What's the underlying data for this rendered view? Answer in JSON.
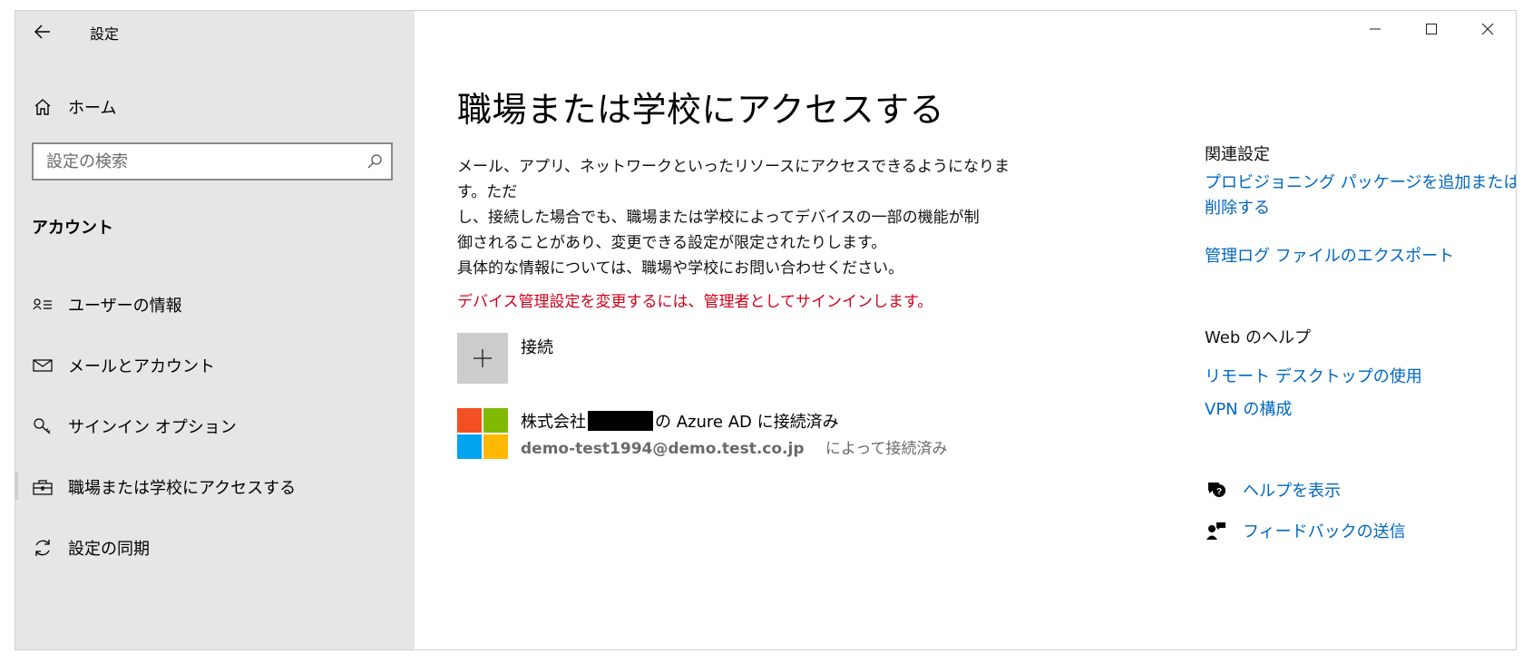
{
  "window": {
    "title": "設定",
    "back_icon": "back-arrow-icon",
    "controls": {
      "minimize": "minimize-icon",
      "maximize": "maximize-icon",
      "close": "close-icon"
    }
  },
  "sidebar": {
    "home_label": "ホーム",
    "search_placeholder": "設定の検索",
    "section_title": "アカウント",
    "items": [
      {
        "label": "ユーザーの情報",
        "icon": "user-info-icon"
      },
      {
        "label": "メールとアカウント",
        "icon": "mail-icon"
      },
      {
        "label": "サインイン オプション",
        "icon": "key-icon"
      },
      {
        "label": "職場または学校にアクセスする",
        "icon": "briefcase-icon",
        "active": true
      },
      {
        "label": "設定の同期",
        "icon": "sync-icon"
      }
    ]
  },
  "main": {
    "title": "職場または学校にアクセスする",
    "description": [
      "メール、アプリ、ネットワークといったリソースにアクセスできるようになります。ただ",
      "し、接続した場合でも、職場または学校によってデバイスの一部の機能が制",
      "御されることがあり、変更できる設定が限定されたりします。",
      "具体的な情報については、職場や学校にお問い合わせください。"
    ],
    "warning": "デバイス管理設定を変更するには、管理者としてサインインします。",
    "connect_label": "接続",
    "account": {
      "org_prefix": "株式会社",
      "org_suffix": "の Azure AD に接続済み",
      "email": "demo-test1994@demo.test.co.jp",
      "connected_by": "によって接続済み",
      "logo_colors": [
        "#f25022",
        "#7fba00",
        "#00a4ef",
        "#ffb900"
      ]
    }
  },
  "related": {
    "heading": "関連設定",
    "link1_line1": "プロビジョニング パッケージを追加または",
    "link1_line2": "削除する",
    "link2": "管理ログ ファイルのエクスポート"
  },
  "web_help": {
    "heading": "Web のヘルプ",
    "link1": "リモート デスクトップの使用",
    "link2": "VPN の構成"
  },
  "help": {
    "show_help": "ヘルプを表示",
    "feedback": "フィードバックの送信"
  },
  "colors": {
    "accent": "#0067c0",
    "warning": "#d0021b",
    "sidebar_bg": "#e6e6e6"
  }
}
